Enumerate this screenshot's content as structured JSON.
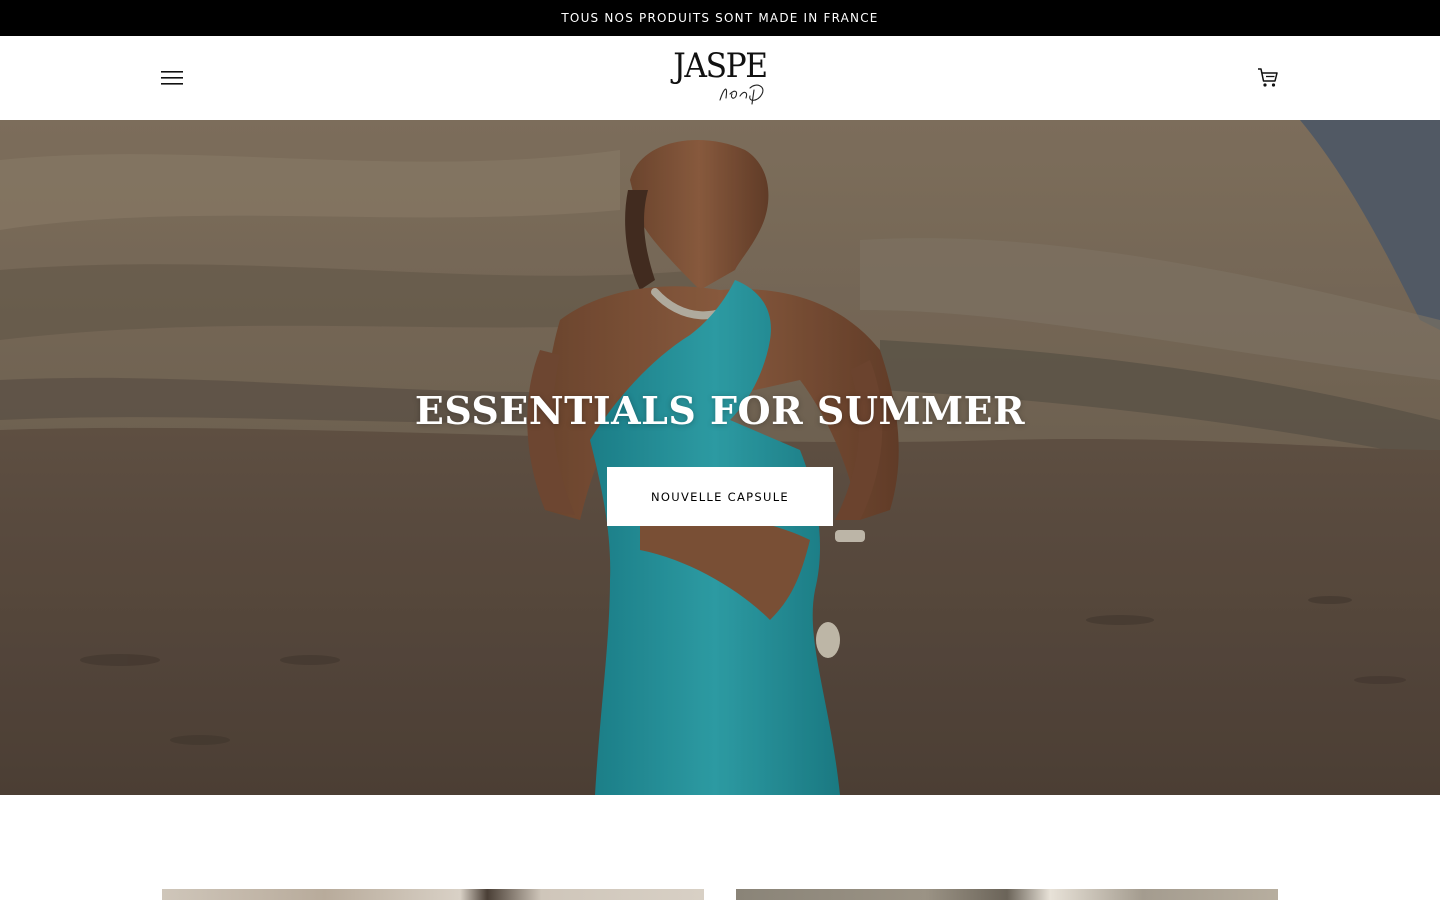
{
  "announcement": {
    "text": "TOUS NOS PRODUITS SONT MADE IN FRANCE"
  },
  "header": {
    "logo_text": "JASPE",
    "logo_signature": "by Dina D",
    "menu_icon": "hamburger-menu-icon",
    "cart_icon": "shopping-cart-icon"
  },
  "hero": {
    "title": "ESSENTIALS FOR SUMMER",
    "cta_label": "NOUVELLE CAPSULE"
  },
  "colors": {
    "announcement_bg": "#000000",
    "announcement_text": "#ffffff",
    "dress": "#2fa6b0",
    "button_bg": "#ffffff"
  }
}
